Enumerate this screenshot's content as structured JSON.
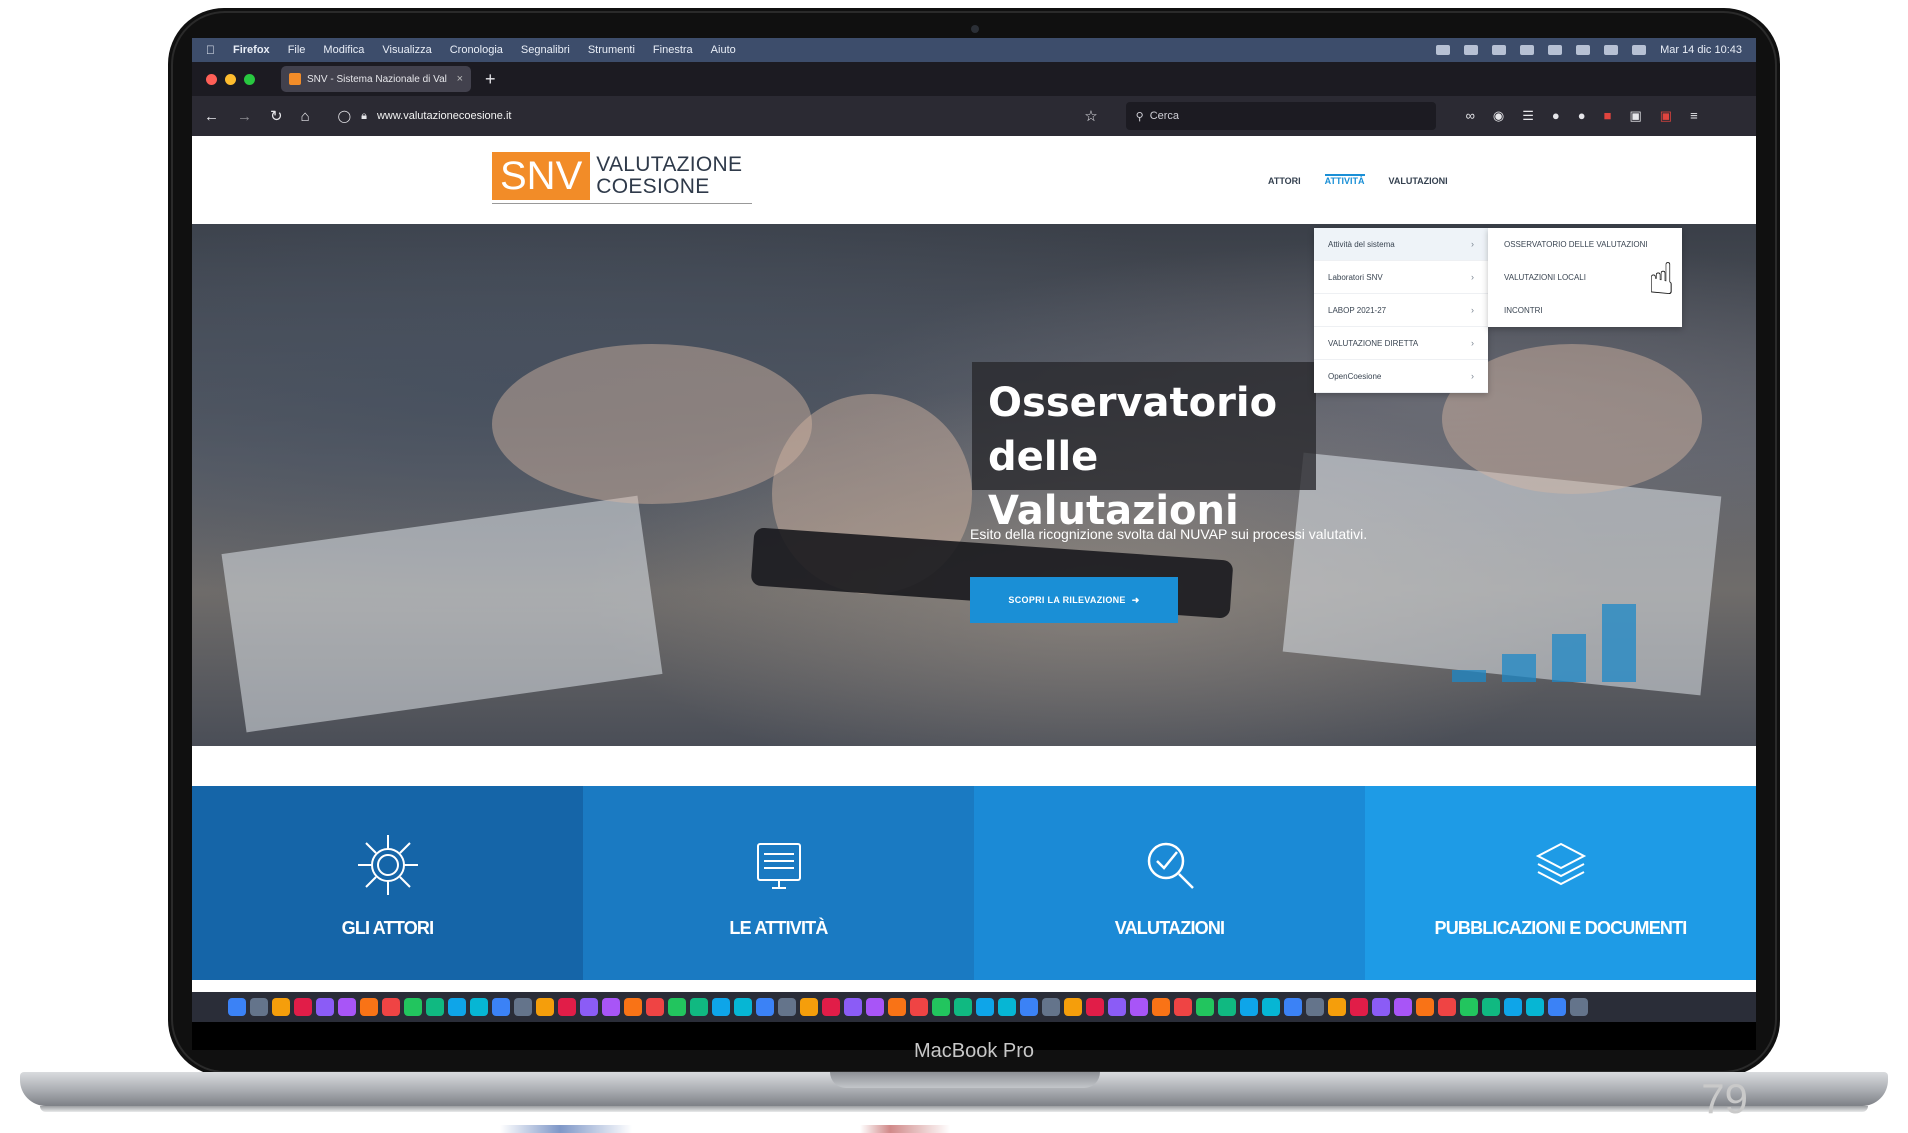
{
  "device": {
    "label": "MacBook Pro",
    "slide_number": "79"
  },
  "menubar": {
    "apple_icon": "apple-icon",
    "items": [
      "Firefox",
      "File",
      "Modifica",
      "Visualizza",
      "Cronologia",
      "Segnalibri",
      "Strumenti",
      "Finestra",
      "Aiuto"
    ],
    "clock": "Mar 14 dic 10:43"
  },
  "browser": {
    "tab_title": "SNV - Sistema Nazionale di Val",
    "tab_close": "×",
    "new_tab": "+",
    "url": "www.valutazionecoesione.it",
    "search_placeholder": "Cerca"
  },
  "site": {
    "logo_snv": "SNV",
    "logo_line1": "VALUTAZIONE",
    "logo_line2": "COESIONE",
    "nav": [
      "ATTORI",
      "ATTIVITÀ",
      "VALUTAZIONI"
    ],
    "dropdown": [
      "Attività del sistema",
      "Laboratori SNV",
      "LABOP 2021-27",
      "VALUTAZIONE DIRETTA",
      "OpenCoesione"
    ],
    "submenu": [
      "OSSERVATORIO DELLE VALUTAZIONI",
      "VALUTAZIONI LOCALI",
      "INCONTRI"
    ],
    "hero": {
      "title_line1": "Osservatorio",
      "title_line2": "delle Valutazioni",
      "subtitle": "Esito della ricognizione svolta dal NUVAP sui processi valutativi.",
      "cta": "SCOPRI LA RILEVAZIONE"
    },
    "tiles": [
      {
        "label": "GLI ATTORI",
        "color": "#1565a8",
        "icon": "network-icon"
      },
      {
        "label": "LE ATTIVITÀ",
        "color": "#1a7ac2",
        "icon": "monitor-icon"
      },
      {
        "label": "VALUTAZIONI",
        "color": "#1b8ad6",
        "icon": "magnifier-check-icon"
      },
      {
        "label": "PUBBLICAZIONI E DOCUMENTI",
        "color": "#1e9be6",
        "icon": "layers-icon"
      }
    ]
  },
  "colors": {
    "accent": "#1a8fd6",
    "brand_orange": "#f28c28"
  }
}
